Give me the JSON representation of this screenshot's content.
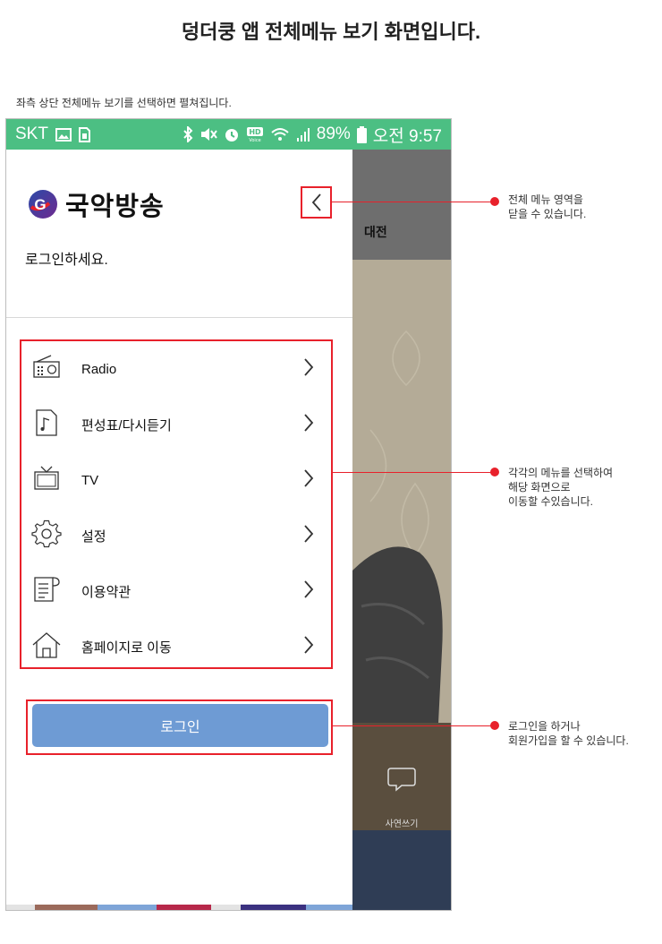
{
  "page_title": "덩더쿵 앱 전체메뉴 보기 화면입니다.",
  "intro": "좌측 상단 전체메뉴 보기를 선택하면 펼쳐집니다.",
  "status_bar": {
    "carrier": "SKT",
    "battery": "89%",
    "time": "오전 9:57",
    "color": "#4cbf83"
  },
  "drawer": {
    "brand": "국악방송",
    "login_prompt": "로그인하세요.",
    "menu": [
      {
        "label": "Radio",
        "icon": "radio-icon"
      },
      {
        "label": "편성표/다시듣기",
        "icon": "music-note-icon"
      },
      {
        "label": "TV",
        "icon": "tv-icon"
      },
      {
        "label": "설정",
        "icon": "gear-icon"
      },
      {
        "label": "이용약관",
        "icon": "document-icon"
      },
      {
        "label": "홈페이지로 이동",
        "icon": "home-icon"
      }
    ],
    "login_button": "로그인",
    "accent_button_color": "#6e9bd4"
  },
  "background_app": {
    "tab_label": "대전",
    "chat_label": "사연쓰기"
  },
  "annotations": {
    "close": [
      "전체 메뉴 영역을",
      "닫을 수 있습니다."
    ],
    "menu": [
      "각각의 메뉴를 선택하여",
      "해당 화면으로",
      "이동할 수있습니다."
    ],
    "login": [
      "로그인을 하거나",
      "회원가입을 할 수 있습니다."
    ],
    "color": "#e8212b"
  }
}
